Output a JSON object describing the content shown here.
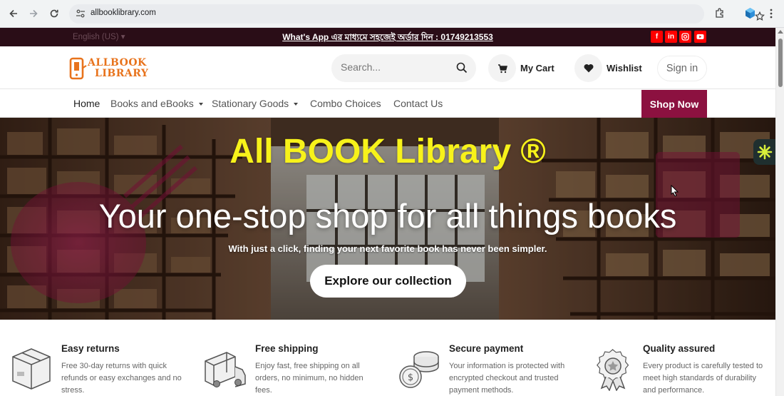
{
  "browser": {
    "url": "allbooklibrary.com"
  },
  "topbar": {
    "language": "English (US)",
    "promo": "What's App এর মাধ্যমে সহজেই অর্ডার দিন : 01749213553",
    "social": [
      "facebook-icon",
      "linkedin-icon",
      "instagram-icon",
      "youtube-icon"
    ]
  },
  "header": {
    "logo_text_line1": "ALLBOOK",
    "logo_text_line2": "LIBRARY",
    "search_placeholder": "Search...",
    "cart_label": "My Cart",
    "wishlist_label": "Wishlist",
    "signin_label": "Sign in"
  },
  "nav": {
    "items": [
      {
        "label": "Home"
      },
      {
        "label": "Books and eBooks"
      },
      {
        "label": "Stationary Goods"
      },
      {
        "label": "Combo Choices"
      },
      {
        "label": "Contact Us"
      }
    ],
    "shop_now": "Shop Now"
  },
  "hero": {
    "title": "All BOOK Library ®",
    "subtitle": "Your one-stop shop for all things books",
    "description": "With just a click, finding your next favorite book has never been simpler.",
    "cta": "Explore our collection"
  },
  "features": [
    {
      "title": "Easy returns",
      "desc": "Free 30-day returns with quick refunds or easy exchanges and no stress.",
      "icon": "box-icon"
    },
    {
      "title": "Free shipping",
      "desc": "Enjoy fast, free shipping on all orders, no minimum, no hidden fees.",
      "icon": "truck-icon"
    },
    {
      "title": "Secure payment",
      "desc": "Your information is protected with encrypted checkout and trusted payment methods.",
      "icon": "coins-icon"
    },
    {
      "title": "Quality assured",
      "desc": "Every product is carefully tested to meet high standards of durability and performance.",
      "icon": "badge-icon"
    }
  ],
  "colors": {
    "topbar_bg": "#2a0d17",
    "brand_accent": "#8c1140",
    "hero_title": "#f7f21a",
    "logo_orange": "#e8731c"
  }
}
